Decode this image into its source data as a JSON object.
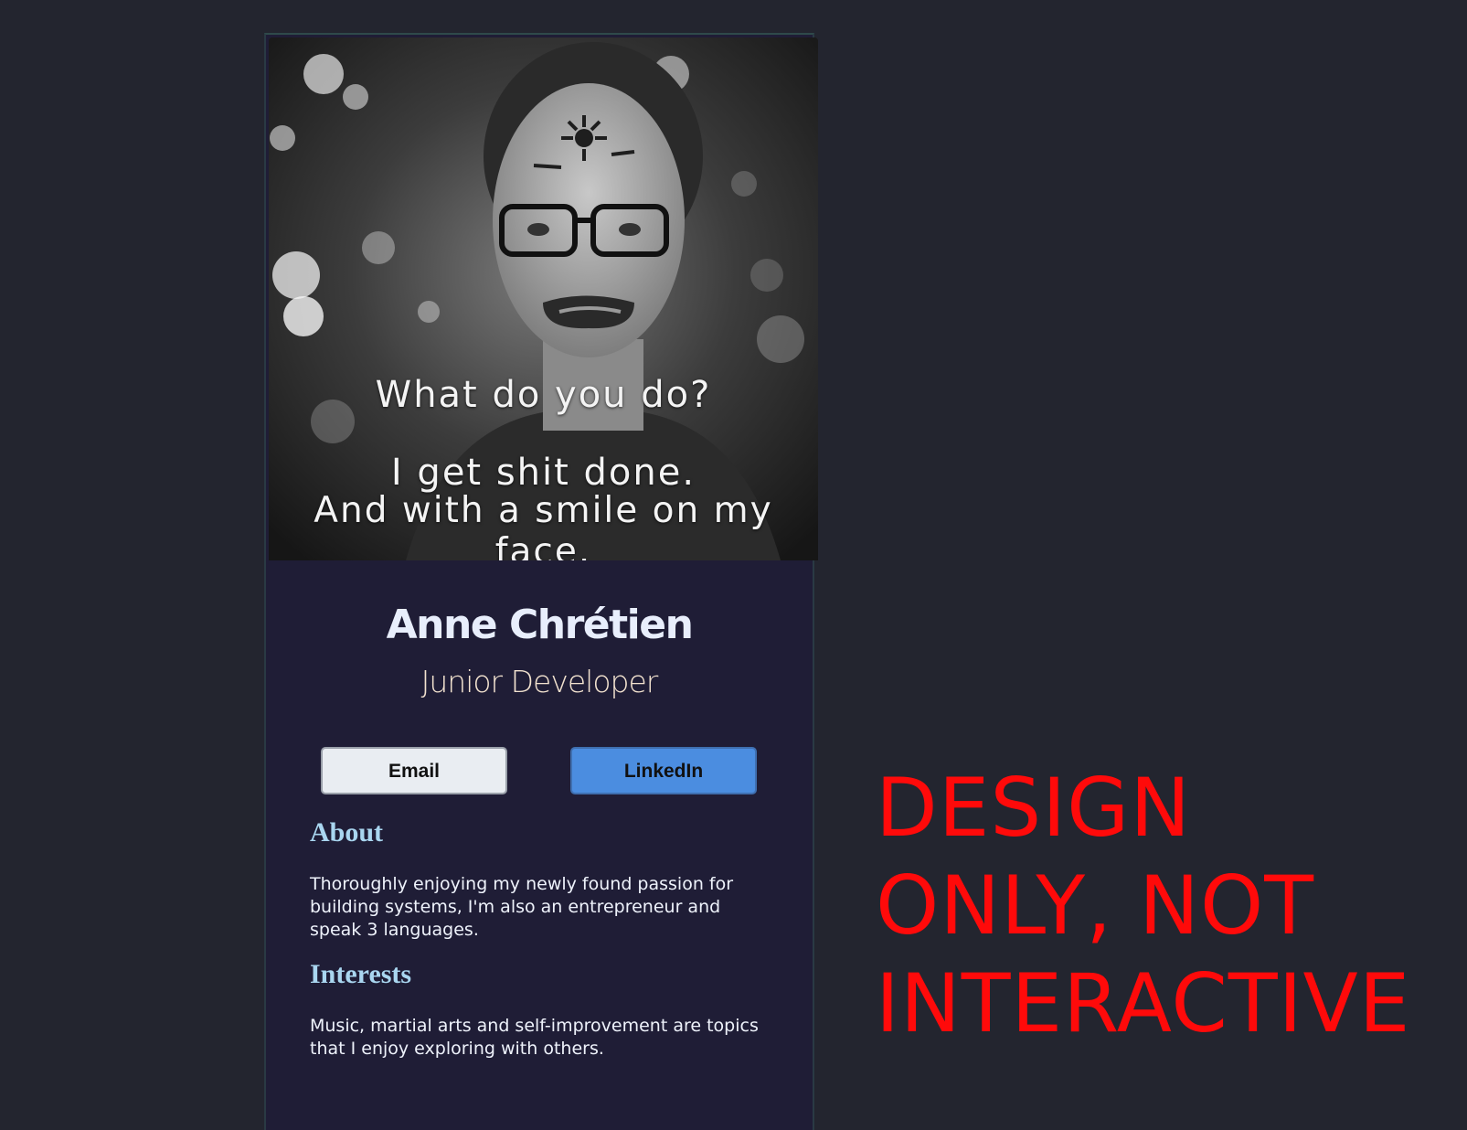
{
  "profile": {
    "photo": {
      "caption_line1": "What do you do?",
      "caption_line2": "I get shit done.",
      "caption_line3": "And with a smile on my face."
    },
    "name": "Anne Chrétien",
    "role": "Junior Developer",
    "buttons": {
      "email_label": "Email",
      "linkedin_label": "LinkedIn"
    },
    "about": {
      "heading": "About",
      "text": "Thoroughly enjoying my newly found passion for building systems, I'm also an entrepreneur and speak 3 languages."
    },
    "interests": {
      "heading": "Interests",
      "text": "Music, martial arts and self-improvement are topics that I enjoy exploring with others."
    }
  },
  "notice": {
    "line1": "DESIGN",
    "line2": "ONLY, NOT",
    "line3": "INTERACTIVE"
  },
  "colors": {
    "page_background": "#23252f",
    "card_background": "#1f1d36",
    "heading_accent": "#a9d6f0",
    "linkedin_button": "#4b8de0",
    "notice_text": "#ff0a0a"
  }
}
